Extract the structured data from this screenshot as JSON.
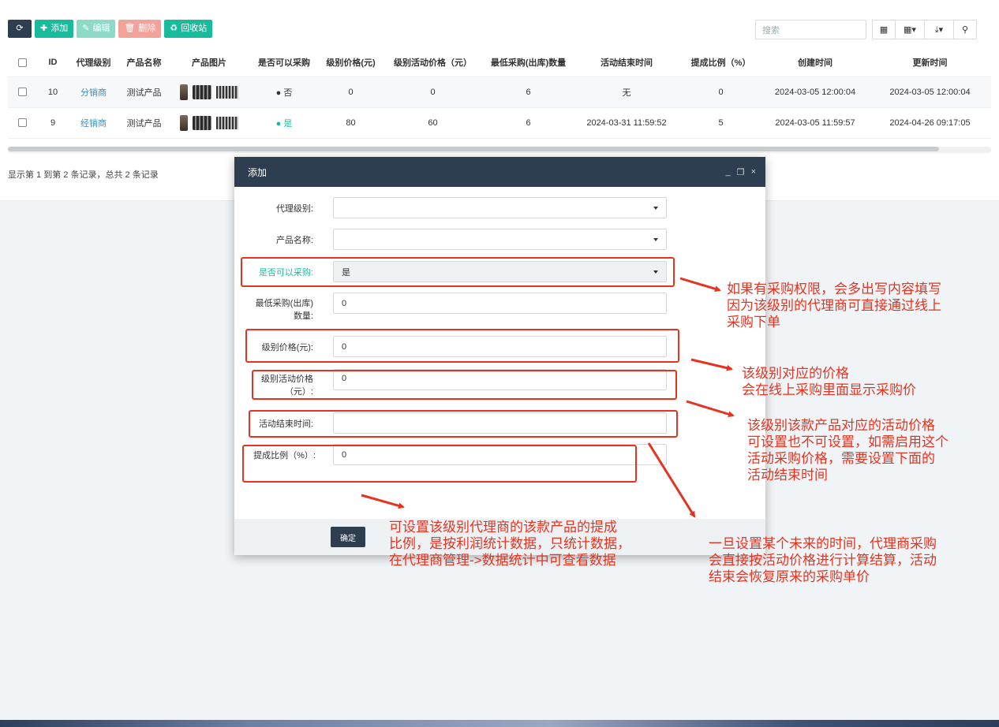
{
  "toolbar": {
    "add_label": "添加",
    "edit_label": "编辑",
    "delete_label": "删除",
    "recycle_label": "回收站",
    "search_placeholder": "搜索"
  },
  "table": {
    "headers": [
      "ID",
      "代理级别",
      "产品名称",
      "产品图片",
      "是否可以采购",
      "级别价格(元)",
      "级别活动价格（元）",
      "最低采购(出库)数量",
      "活动结束时间",
      "提成比例（%）",
      "创建时间",
      "更新时间"
    ],
    "rows": [
      {
        "id": "10",
        "level": "分销商",
        "product": "测试产品",
        "purchasable": "否",
        "price": "0",
        "activity_price": "0",
        "min_qty": "6",
        "end_time": "无",
        "commission": "0",
        "created": "2024-03-05 12:00:04",
        "updated": "2024-03-05 12:00:04"
      },
      {
        "id": "9",
        "level": "经销商",
        "product": "测试产品",
        "purchasable": "是",
        "price": "80",
        "activity_price": "60",
        "min_qty": "6",
        "end_time": "2024-03-31 11:59:52",
        "commission": "5",
        "created": "2024-03-05 11:59:57",
        "updated": "2024-04-26 09:17:05"
      }
    ],
    "pager_text": "显示第 1 到第 2 条记录，总共 2 条记录"
  },
  "modal": {
    "title": "添加",
    "fields": {
      "level_label": "代理级别:",
      "product_label": "产品名称:",
      "purchasable_label": "是否可以采购:",
      "purchasable_value": "是",
      "min_qty_label_1": "最低采购(出库)",
      "min_qty_label_2": "数量:",
      "min_qty_value": "0",
      "price_label": "级别价格(元):",
      "price_value": "0",
      "activity_price_label_1": "级别活动价格",
      "activity_price_label_2": "（元）:",
      "activity_price_value": "0",
      "end_time_label": "活动结束时间:",
      "commission_label": "提成比例（%）:",
      "commission_value": "0"
    },
    "ok_label": "确定"
  },
  "annotations": {
    "note1": "如果有采购权限，会多出写内容填写\n因为该级别的代理商可直接通过线上\n采购下单",
    "note2": "该级别对应的价格\n会在线上采购里面显示采购价",
    "note3": "该级别该款产品对应的活动价格\n可设置也不可设置，如需启用这个\n活动采购价格，需要设置下面的\n活动结束时间",
    "note4": "可设置该级别代理商的该款产品的提成\n比例，是按利润统计数据，只统计数据，\n在代理商管理->数据统计中可查看数据",
    "note5": "一旦设置某个未来的时间，代理商采购\n会直接按活动价格进行计算结算，活动\n结束会恢复原来的采购单价",
    "color": "#e5331f"
  },
  "colors": {
    "primary": "#2c3e50",
    "success": "#18bc9c",
    "link": "#3c8dbc"
  }
}
